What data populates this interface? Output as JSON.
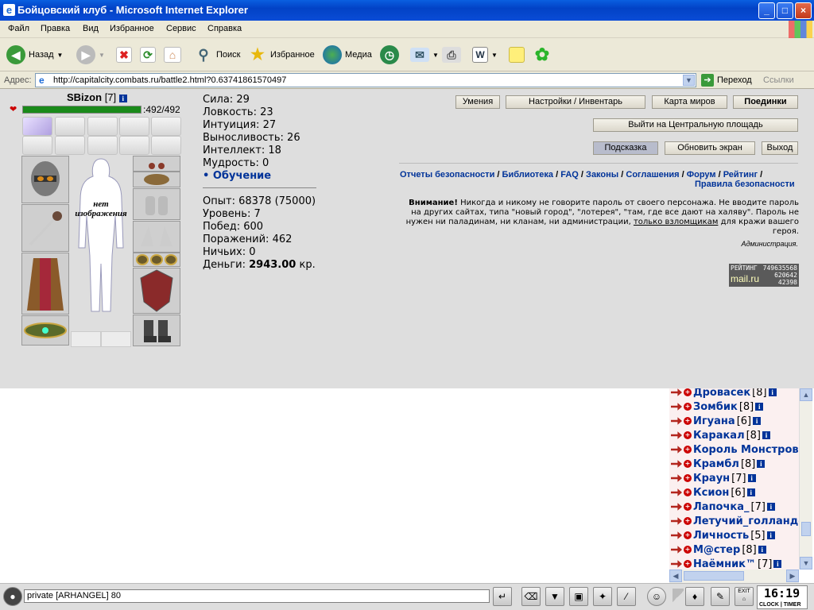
{
  "window": {
    "title": "Бойцовский клуб - Microsoft Internet Explorer",
    "minimize": "_",
    "maximize": "□",
    "close": "×"
  },
  "menu": [
    "Файл",
    "Правка",
    "Вид",
    "Избранное",
    "Сервис",
    "Справка"
  ],
  "toolbar": {
    "back": "Назад",
    "search": "Поиск",
    "favorites": "Избранное",
    "media": "Медиа"
  },
  "address": {
    "label": "Адрес:",
    "url": "http://capitalcity.combats.ru/battle2.html?0.63741861570497",
    "go": "Переход",
    "links": "Ссылки"
  },
  "character": {
    "name": "SBizon",
    "level": "[7]",
    "hp": "492/492",
    "hp_fraction": 1.0,
    "no_image": "нет изображения"
  },
  "stats": [
    "Сила: 29",
    "Ловкость: 23",
    "Интуиция: 27",
    "Выносливость: 26",
    "Интеллект: 18",
    "Мудрость: 0"
  ],
  "training": "Обучение",
  "progress": [
    "Опыт: 68378 (75000)",
    "Уровень: 7",
    "Побед: 600",
    "Поражений: 462",
    "Ничьих: 0"
  ],
  "money": {
    "label": "Деньги:",
    "value": "2943.00",
    "unit": "кр."
  },
  "buttons": {
    "skills": "Умения",
    "settings": "Настройки / Инвентарь",
    "map": "Карта миров",
    "duels": "Поединки",
    "square": "Выйти на Центральную площадь",
    "hint": "Подсказка",
    "refresh": "Обновить экран",
    "exit": "Выход"
  },
  "nav_links": [
    "Отчеты безопасности",
    "Библиотека",
    "FAQ",
    "Законы",
    "Соглашения",
    "Форум",
    "Рейтинг",
    "Правила безопасности"
  ],
  "warning": {
    "bold": "Внимание!",
    "text": "Никогда и никому не говорите пароль от своего персонажа. Не вводите пароль на других сайтах, типа \"новый город\", \"лотерея\", \"там, где все дают на халяву\". Пароль не нужен ни паладинам, ни кланам, ни администрации,",
    "link": "только взломщикам",
    "tail": "для кражи вашего героя.",
    "sign": "Администрация."
  },
  "rating": {
    "label": "РЕЙТИНГ",
    "n1": "749635568",
    "n2": "620642",
    "n3": "42398",
    "brand": "mail.ru"
  },
  "chat_users": [
    {
      "name": "Дровасек",
      "level": "[8]"
    },
    {
      "name": "Зомбик",
      "level": "[8]"
    },
    {
      "name": "Игуана",
      "level": "[6]"
    },
    {
      "name": "Каракал",
      "level": "[8]"
    },
    {
      "name": "Король Монстров",
      "level": ""
    },
    {
      "name": "Крамбл",
      "level": "[8]"
    },
    {
      "name": "Краун",
      "level": "[7]"
    },
    {
      "name": "Ксион",
      "level": "[6]"
    },
    {
      "name": "Лапочка_",
      "level": "[7]"
    },
    {
      "name": "Летучий_голландец",
      "level": ""
    },
    {
      "name": "Личность",
      "level": "[5]"
    },
    {
      "name": "М@стер",
      "level": "[8]"
    },
    {
      "name": "Наёмник™",
      "level": "[7]"
    }
  ],
  "chat_input": "private [ARHANGEL] 80",
  "clock": {
    "time": "16:19",
    "label": "CLOCK | TIMER",
    "exit": "EXIT"
  },
  "colors": {
    "hp": "#1a8a1a",
    "link": "#003399",
    "game_bg": "#dedede"
  }
}
